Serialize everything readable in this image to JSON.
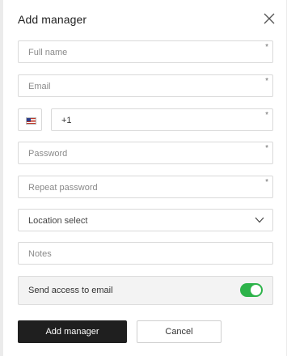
{
  "dialog": {
    "title": "Add manager"
  },
  "form": {
    "full_name": {
      "placeholder": "Full name",
      "required_mark": "*"
    },
    "email": {
      "placeholder": "Email",
      "required_mark": "*"
    },
    "phone": {
      "country_icon": "us-flag-icon",
      "value": "+1",
      "required_mark": "*"
    },
    "password": {
      "placeholder": "Password",
      "required_mark": "*"
    },
    "repeat_password": {
      "placeholder": "Repeat password",
      "required_mark": "*"
    },
    "location": {
      "placeholder": "Location select",
      "icon": "chevron-down-icon"
    },
    "notes": {
      "placeholder": "Notes"
    },
    "send_access": {
      "label": "Send access to email",
      "enabled": true,
      "accent": "#2db34a"
    }
  },
  "actions": {
    "primary_label": "Add manager",
    "secondary_label": "Cancel"
  }
}
